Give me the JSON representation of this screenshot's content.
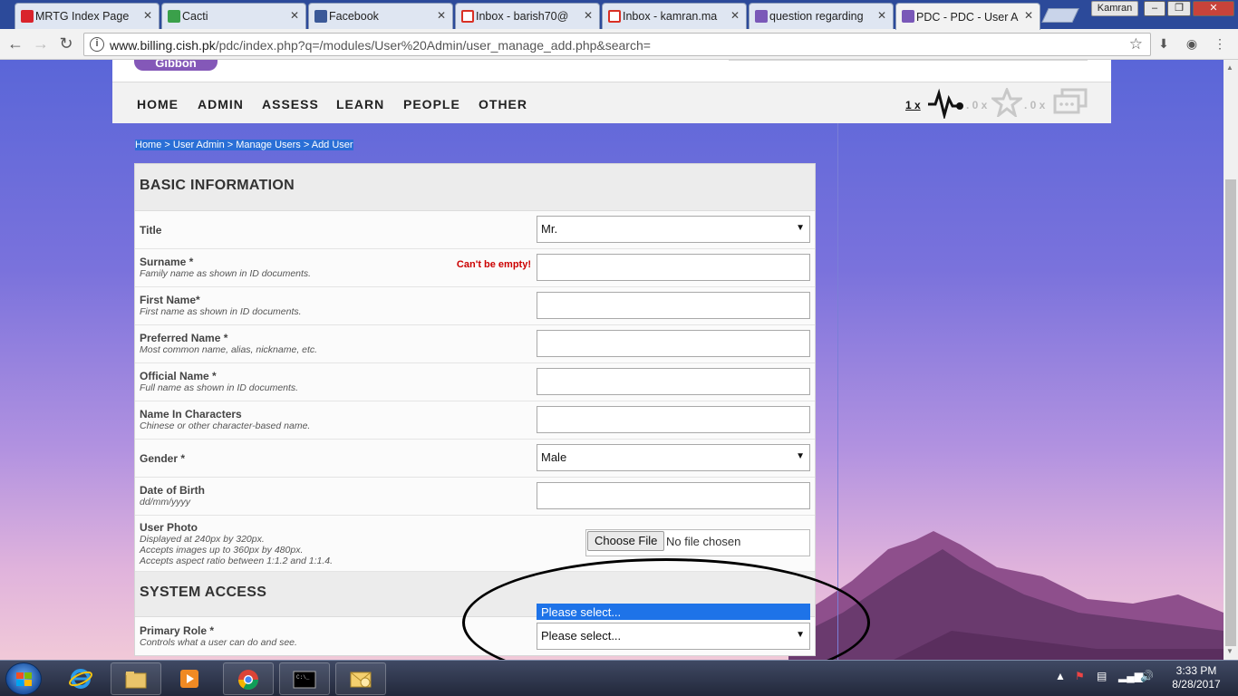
{
  "browser": {
    "tabs": [
      {
        "title": "MRTG Index Page",
        "favicon": "huawei-icon",
        "color": "#d9232c"
      },
      {
        "title": "Cacti",
        "favicon": "cacti-icon",
        "color": "#3aa04a"
      },
      {
        "title": "Facebook",
        "favicon": "facebook-icon",
        "color": "#3b5998"
      },
      {
        "title": "Inbox - barish70@",
        "favicon": "gmail-icon",
        "color": "#d93025"
      },
      {
        "title": "Inbox - kamran.ma",
        "favicon": "gmail-icon",
        "color": "#d93025"
      },
      {
        "title": "question regarding",
        "favicon": "gibbon-icon",
        "color": "#7a58b8"
      },
      {
        "title": "PDC - PDC - User A",
        "favicon": "gibbon-icon",
        "color": "#7a58b8"
      }
    ],
    "user_chip": "Kamran",
    "url_host": "www.billing.cish.pk",
    "url_path": "/pdc/index.php?q=/modules/User%20Admin/user_manage_add.php&search="
  },
  "site": {
    "logo": "Gibbon",
    "nav": [
      "HOME",
      "ADMIN",
      "ASSESS",
      "LEARN",
      "PEOPLE",
      "OTHER"
    ],
    "notifications": {
      "alarms": "1 x",
      "likes": ". 0 x",
      "messages": ". 0 x"
    }
  },
  "breadcrumb": "Home > User Admin > Manage Users > Add User",
  "form": {
    "basic_heading": "BASIC INFORMATION",
    "system_heading": "SYSTEM ACCESS",
    "title": {
      "label": "Title",
      "value": "Mr."
    },
    "surname": {
      "label": "Surname *",
      "hint": "Family name as shown in ID documents.",
      "error": "Can't be empty!"
    },
    "first_name": {
      "label": "First Name*",
      "hint": "First name as shown in ID documents."
    },
    "preferred_name": {
      "label": "Preferred Name *",
      "hint": "Most common name, alias, nickname, etc."
    },
    "official_name": {
      "label": "Official Name *",
      "hint": "Full name as shown in ID documents."
    },
    "name_chars": {
      "label": "Name In Characters",
      "hint": "Chinese or other character-based name."
    },
    "gender": {
      "label": "Gender *",
      "value": "Male"
    },
    "dob": {
      "label": "Date of Birth",
      "hint": "dd/mm/yyyy"
    },
    "photo": {
      "label": "User Photo",
      "hint1": "Displayed at 240px by 320px.",
      "hint2": "Accepts images up to 360px by 480px.",
      "hint3": "Accepts aspect ratio between 1:1.2 and 1:1.4.",
      "button": "Choose File",
      "status": "No file chosen"
    },
    "primary_role": {
      "label": "Primary Role *",
      "hint": "Controls what a user can do and see.",
      "value": "Please select...",
      "open_option": "Please select..."
    }
  },
  "taskbar": {
    "time": "3:33 PM",
    "date": "8/28/2017"
  }
}
